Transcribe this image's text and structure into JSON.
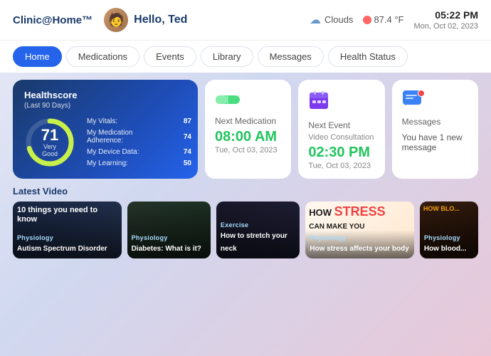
{
  "header": {
    "logo": "Clinic@Home™",
    "greeting": "Hello, Ted",
    "weather_icon": "☁",
    "weather_label": "Clouds",
    "temp": "87.4 °F",
    "time": "05:22 PM",
    "date": "Mon, Oct 02, 2023"
  },
  "nav": {
    "items": [
      {
        "label": "Home",
        "active": true
      },
      {
        "label": "Medications",
        "active": false
      },
      {
        "label": "Events",
        "active": false
      },
      {
        "label": "Library",
        "active": false
      },
      {
        "label": "Messages",
        "active": false
      },
      {
        "label": "Health Status",
        "active": false
      }
    ]
  },
  "health_card": {
    "title": "Healthscore",
    "subtitle": "(Last 90 Days)",
    "score": "71",
    "score_label": "Very Good",
    "metrics": [
      {
        "name": "My Vitals:",
        "value": "87",
        "pct": 87,
        "color": "#22c55e"
      },
      {
        "name": "My Medication Adherence:",
        "value": "74",
        "pct": 74,
        "color": "#facc15"
      },
      {
        "name": "My Device Data:",
        "value": "74",
        "pct": 74,
        "color": "#22c55e"
      },
      {
        "name": "My Learning:",
        "value": "50",
        "pct": 50,
        "color": "#facc15"
      }
    ]
  },
  "next_medication": {
    "icon": "💊",
    "label": "Next Medication",
    "time": "08:00 AM",
    "date": "Tue, Oct 03, 2023"
  },
  "next_event": {
    "icon": "📅",
    "label": "Next Event",
    "sublabel": "Video Consultation",
    "time": "02:30 PM",
    "date": "Tue, Oct 03, 2023"
  },
  "messages": {
    "icon": "💬",
    "label": "Messages",
    "text": "You have 1 new message"
  },
  "latest_video": {
    "title": "Latest Video",
    "videos": [
      {
        "category": "Physiology",
        "title": "Autism Spectrum Disorder",
        "title_large": "10 things you need to know",
        "bg_color": "#1a2a4a",
        "accent": "#3b82f6"
      },
      {
        "category": "Physiology",
        "title": "Diabetes: What is it?",
        "bg_color": "#2d4a3e",
        "accent": "#4ade80"
      },
      {
        "category": "Exercise",
        "title": "How to stretch your neck",
        "bg_color": "#1a1a2e",
        "accent": "#a78bfa"
      },
      {
        "category": "Physiology",
        "title": "How stress affects your body",
        "title_large": "HOW STRESS CAN MAKE YOU",
        "bg_color": "#fff8f0",
        "accent": "#f97316"
      },
      {
        "category": "Physiology",
        "title": "How blood...",
        "bg_color": "#2a1a0e",
        "accent": "#f59e0b"
      }
    ]
  }
}
